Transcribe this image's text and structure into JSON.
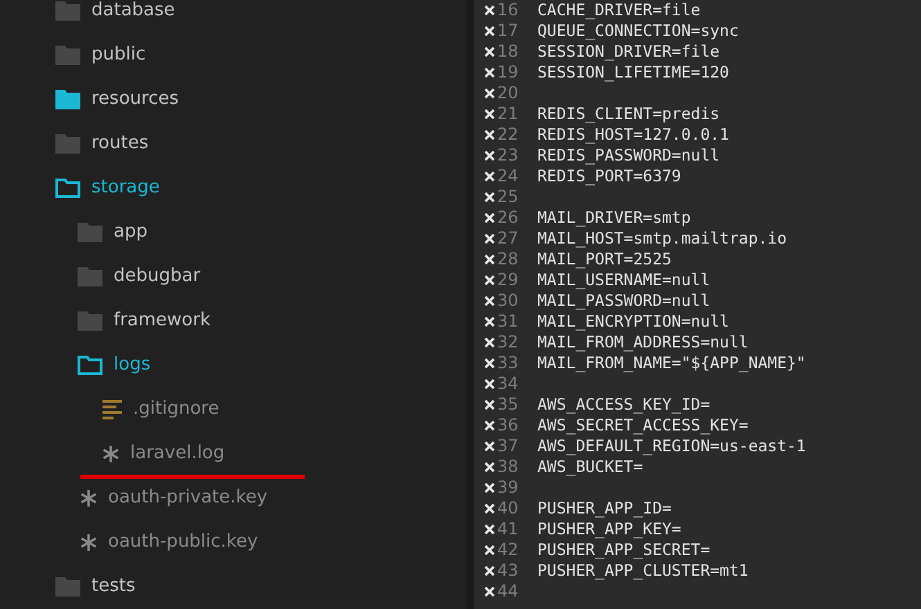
{
  "sidebar": {
    "items": [
      {
        "kind": "folder",
        "name": "database",
        "expanded": false,
        "highlighted": false
      },
      {
        "kind": "folder",
        "name": "public",
        "expanded": false,
        "highlighted": false
      },
      {
        "kind": "folder",
        "name": "resources",
        "expanded": false,
        "highlighted": true
      },
      {
        "kind": "folder",
        "name": "routes",
        "expanded": false,
        "highlighted": false
      },
      {
        "kind": "folder",
        "name": "storage",
        "expanded": true,
        "highlighted": false,
        "children": [
          {
            "kind": "folder",
            "name": "app",
            "expanded": false,
            "highlighted": false
          },
          {
            "kind": "folder",
            "name": "debugbar",
            "expanded": false,
            "highlighted": false
          },
          {
            "kind": "folder",
            "name": "framework",
            "expanded": false,
            "highlighted": false
          },
          {
            "kind": "folder",
            "name": "logs",
            "expanded": true,
            "highlighted": false,
            "children": [
              {
                "kind": "text-file",
                "name": ".gitignore",
                "underlined": false
              },
              {
                "kind": "generic-file",
                "name": "laravel.log",
                "underlined": true
              }
            ]
          },
          {
            "kind": "generic-file",
            "name": "oauth-private.key",
            "underlined": false
          },
          {
            "kind": "generic-file",
            "name": "oauth-public.key",
            "underlined": false
          }
        ]
      },
      {
        "kind": "folder",
        "name": "tests",
        "expanded": false,
        "highlighted": false
      }
    ]
  },
  "editor": {
    "lines": [
      {
        "number": "16",
        "changed": true,
        "text": "CACHE_DRIVER=file"
      },
      {
        "number": "17",
        "changed": true,
        "text": "QUEUE_CONNECTION=sync"
      },
      {
        "number": "18",
        "changed": true,
        "text": "SESSION_DRIVER=file"
      },
      {
        "number": "19",
        "changed": true,
        "text": "SESSION_LIFETIME=120"
      },
      {
        "number": "20",
        "changed": true
      },
      {
        "number": "21",
        "changed": true,
        "text": "REDIS_CLIENT=predis"
      },
      {
        "number": "22",
        "changed": true,
        "text": "REDIS_HOST=127.0.0.1"
      },
      {
        "number": "23",
        "changed": true,
        "text": "REDIS_PASSWORD=null"
      },
      {
        "number": "24",
        "changed": true,
        "text": "REDIS_PORT=6379"
      },
      {
        "number": "25",
        "changed": true
      },
      {
        "number": "26",
        "changed": true,
        "text": "MAIL_DRIVER=smtp"
      },
      {
        "number": "27",
        "changed": true,
        "text": "MAIL_HOST=smtp.mailtrap.io"
      },
      {
        "number": "28",
        "changed": true,
        "text": "MAIL_PORT=2525"
      },
      {
        "number": "29",
        "changed": true,
        "text": "MAIL_USERNAME=null"
      },
      {
        "number": "30",
        "changed": true,
        "text": "MAIL_PASSWORD=null"
      },
      {
        "number": "31",
        "changed": true,
        "text": "MAIL_ENCRYPTION=null"
      },
      {
        "number": "32",
        "changed": true,
        "text": "MAIL_FROM_ADDRESS=null"
      },
      {
        "number": "33",
        "changed": true,
        "text": "MAIL_FROM_NAME=\"${APP_NAME}\""
      },
      {
        "number": "34",
        "changed": true
      },
      {
        "number": "35",
        "changed": true,
        "text": "AWS_ACCESS_KEY_ID="
      },
      {
        "number": "36",
        "changed": true,
        "text": "AWS_SECRET_ACCESS_KEY="
      },
      {
        "number": "37",
        "changed": true,
        "text": "AWS_DEFAULT_REGION=us-east-1"
      },
      {
        "number": "38",
        "changed": true,
        "text": "AWS_BUCKET="
      },
      {
        "number": "39",
        "changed": true
      },
      {
        "number": "40",
        "changed": true,
        "text": "PUSHER_APP_ID="
      },
      {
        "number": "41",
        "changed": true,
        "text": "PUSHER_APP_KEY="
      },
      {
        "number": "42",
        "changed": true,
        "text": "PUSHER_APP_SECRET="
      },
      {
        "number": "43",
        "changed": true,
        "text": "PUSHER_APP_CLUSTER=mt1"
      },
      {
        "number": "44",
        "changed": true
      }
    ]
  }
}
